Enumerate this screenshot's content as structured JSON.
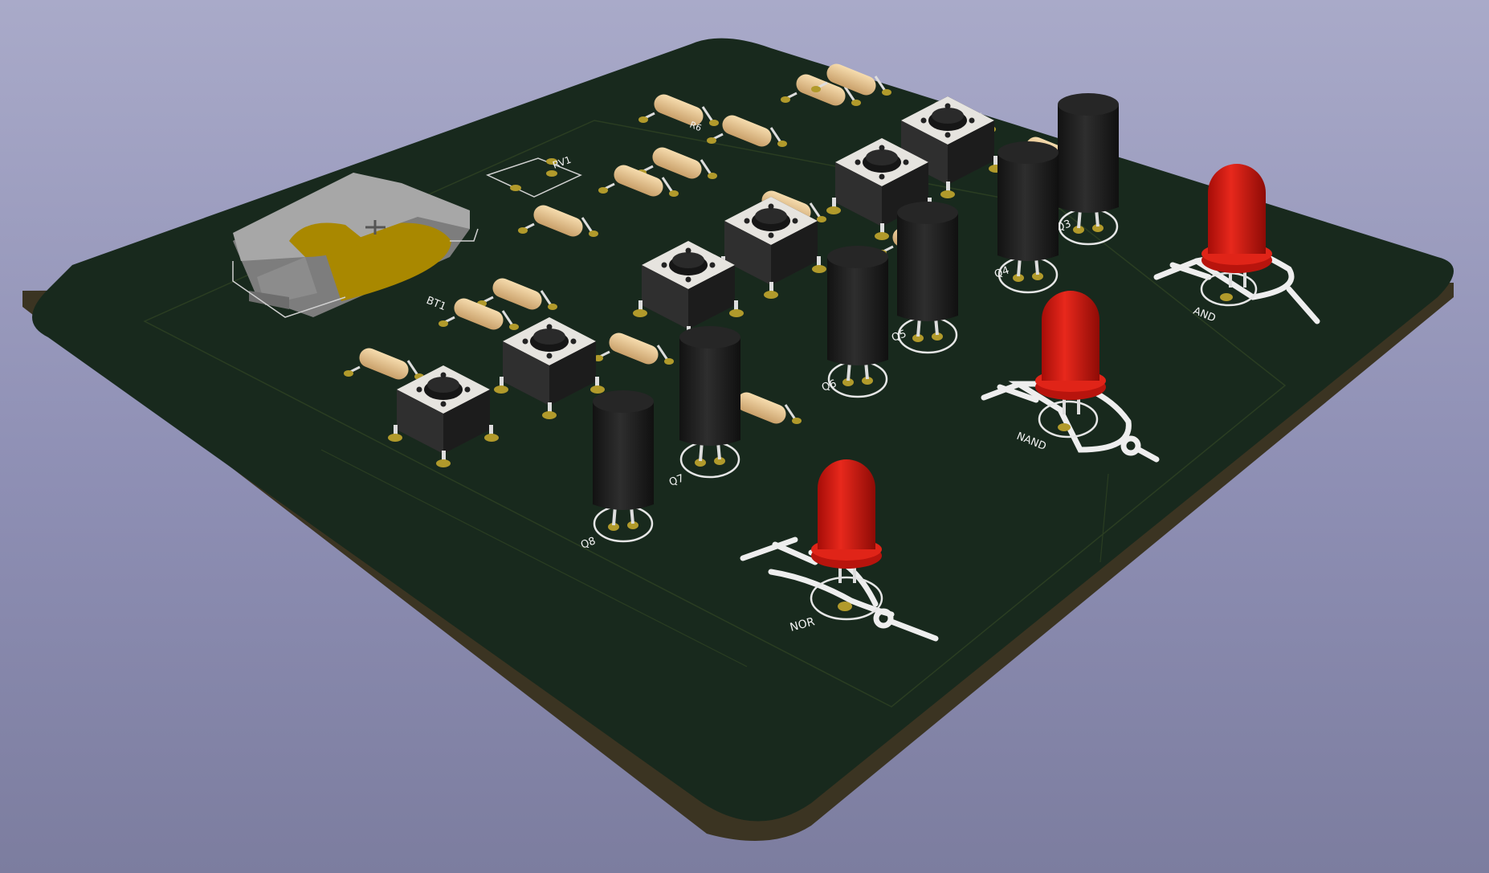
{
  "viewer": {
    "background_top": "#a9aac9",
    "background_bottom": "#7c7d9f"
  },
  "board": {
    "soldermask_color": "#18291d",
    "edge_color": "#3b3422",
    "silkscreen_color": "#f2f2f2",
    "copper_pad_color": "#b19a2b",
    "battery": {
      "ref": "BT1",
      "marking": "+"
    },
    "trimpot": {
      "ref": "RV1"
    },
    "resistor_label": "R6",
    "transistors": [
      "Q3",
      "Q4",
      "Q5",
      "Q6",
      "Q7",
      "Q8"
    ],
    "gates": [
      {
        "label": "AND",
        "led_color": "#d01a12"
      },
      {
        "label": "NAND",
        "led_color": "#d01a12"
      },
      {
        "label": "NOR",
        "led_color": "#d01a12"
      }
    ],
    "component_colors": {
      "resistor_body": "#e7c48e",
      "transistor_body": "#1f1f1f",
      "switch_body": "#2b2b2b",
      "switch_top": "#e6e4df",
      "battery_holder": "#9a9a9a",
      "battery_cell": "#a98800"
    }
  }
}
